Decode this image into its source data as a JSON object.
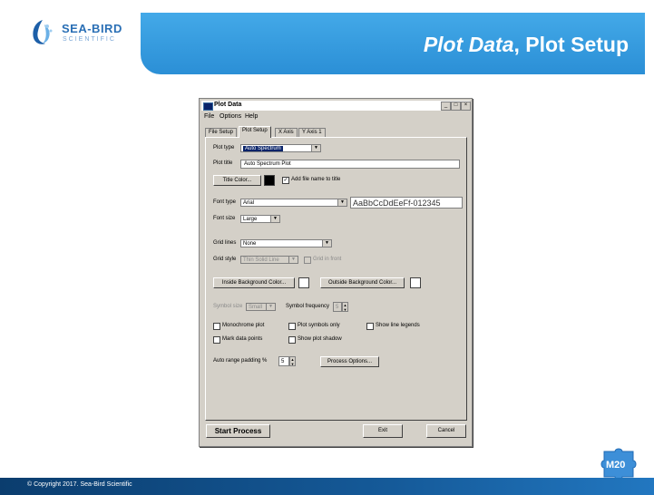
{
  "slide": {
    "logo_text": "SEA-BIRD",
    "logo_subtext": "SCIENTIFIC",
    "title_italic": "Plot Data",
    "title_rest": ", Plot Setup",
    "copyright": "© Copyright 2017. Sea-Bird Scientific",
    "badge": "M20",
    "colors": {
      "banner": "#2b8fd6",
      "footer": "#155a99"
    }
  },
  "window": {
    "title": "Plot Data",
    "controls": {
      "minimize": "_",
      "maximize": "□",
      "close": "×"
    },
    "menu": [
      "File",
      "Options",
      "Help"
    ],
    "tabs": [
      "File Setup",
      "Plot Setup",
      "X Axis",
      "Y Axis 1"
    ],
    "active_tab": "Plot Setup",
    "plot_type": {
      "label": "Plot type",
      "value": "Auto Spectrum"
    },
    "plot_title": {
      "label": "Plot title",
      "value": "Auto Spectrum Plot"
    },
    "title_color_button": "Title Color...",
    "add_file_name": {
      "label": "Add file name to title",
      "checked": true
    },
    "font_type": {
      "label": "Font type",
      "value": "Arial",
      "preview": "AaBbCcDdEeFf-012345"
    },
    "font_size": {
      "label": "Font size",
      "value": "Large"
    },
    "grid_lines": {
      "label": "Grid lines",
      "value": "None"
    },
    "grid_style": {
      "label": "Grid style",
      "value": "Thin Solid Line"
    },
    "grid_in_front": {
      "label": "Grid in front",
      "checked": false
    },
    "inside_bg_button": "Inside Background Color...",
    "outside_bg_button": "Outside Background Color...",
    "symbol_size": {
      "label": "Symbol size",
      "value": "Small"
    },
    "symbol_frequency": {
      "label": "Symbol frequency",
      "value": "5"
    },
    "checkboxes": [
      {
        "label": "Monochrome plot",
        "checked": false
      },
      {
        "label": "Plot symbols only",
        "checked": false
      },
      {
        "label": "Show line legends",
        "checked": false
      },
      {
        "label": "Mark data points",
        "checked": false
      },
      {
        "label": "Show plot shadow",
        "checked": false
      }
    ],
    "auto_range": {
      "label": "Auto range padding %",
      "value": "5"
    },
    "process_options_button": "Process Options...",
    "start_process_button": "Start Process",
    "exit_button": "Exit",
    "cancel_button": "Cancel",
    "colors": {
      "title_color": "#000000",
      "inside_bg": "#ffffff",
      "outside_bg": "#ffffff"
    }
  }
}
